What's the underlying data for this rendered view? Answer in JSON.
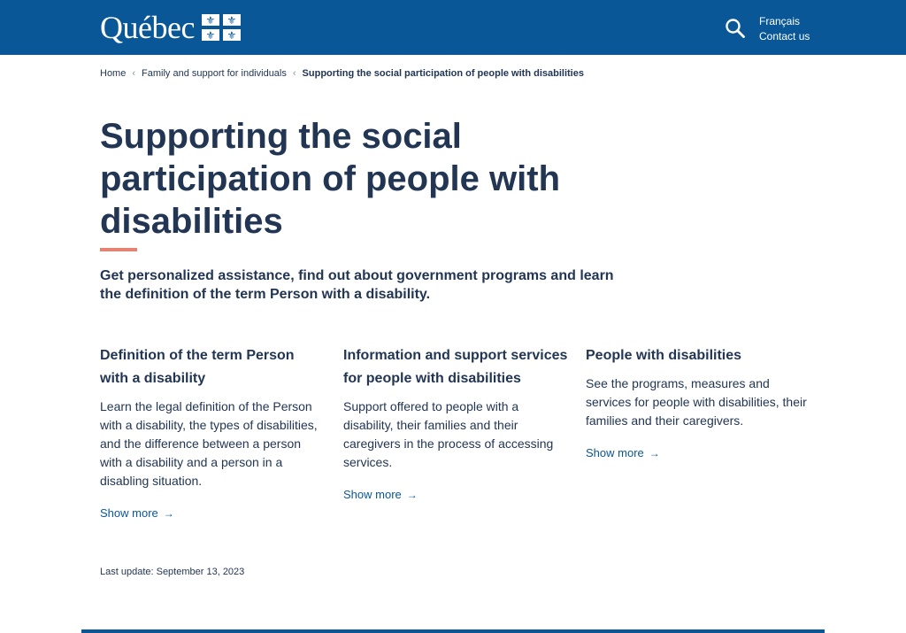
{
  "header": {
    "logo_text": "Québec",
    "flag_glyph": "⚜",
    "search_icon": "search-icon",
    "language_link": "Français",
    "contact_link": "Contact us",
    "brand_color": "#095797"
  },
  "breadcrumb": {
    "items": [
      "Home",
      "Family and support for individuals"
    ],
    "current": "Supporting the social participation of people with disabilities",
    "separator": "‹"
  },
  "main": {
    "title": "Supporting the social participation of people with disabilities",
    "accent_color": "#e58271",
    "lead": "Get personalized assistance, find out about government programs and learn the definition of the term Person with a disability."
  },
  "cards": [
    {
      "title": "Definition of the term Person with a disability",
      "text": "Learn the legal definition of the Person with a disability, the types of disabilities, and the difference between a person with a disability and a person in a disabling situation.",
      "link": "Show more"
    },
    {
      "title": "Information and support services for people with disabilities",
      "text": "Support offered to people with a disability, their families and their caregivers in the process of accessing services.",
      "link": "Show more"
    },
    {
      "title": "People with disabilities",
      "text": "See the programs, measures and services for people with disabilities, their families and their caregivers.",
      "link": "Show more"
    }
  ],
  "footer": {
    "last_update": "Last update: September 13, 2023"
  }
}
